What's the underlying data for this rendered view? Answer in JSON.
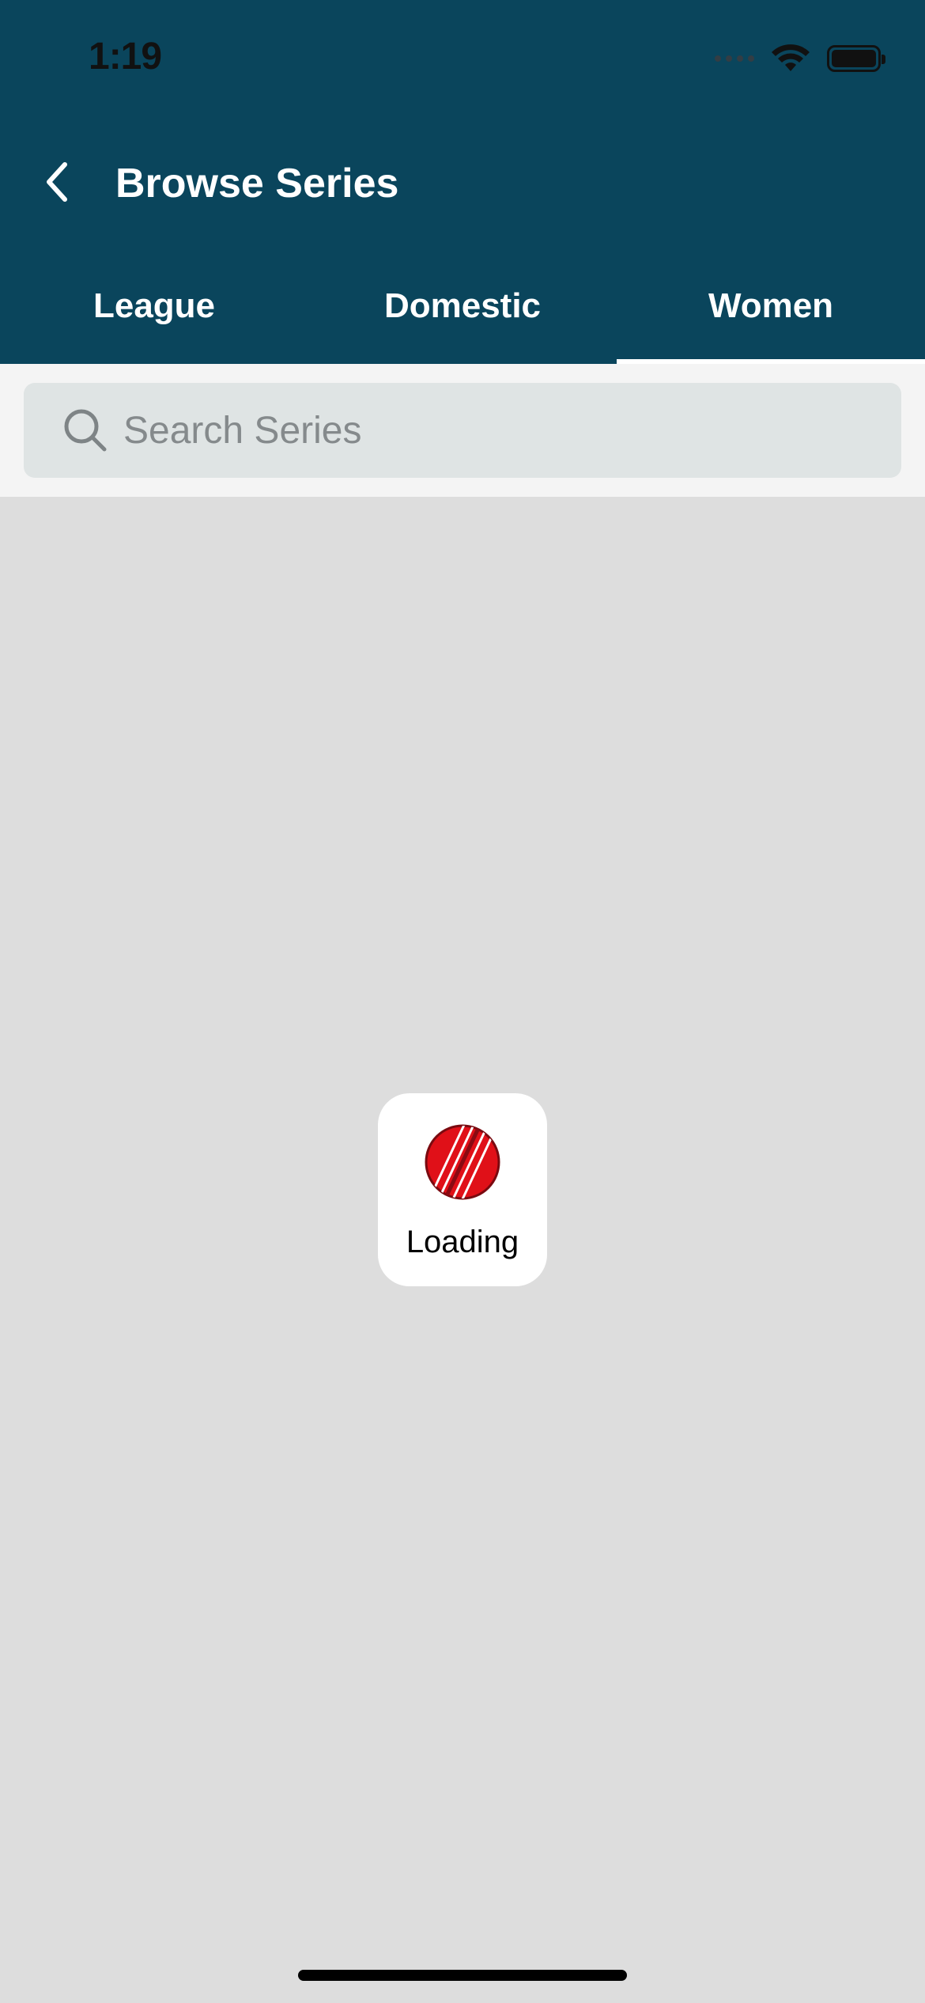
{
  "status_bar": {
    "time": "1:19"
  },
  "header": {
    "title": "Browse Series",
    "back_icon": "chevron-left-icon",
    "background_color": "#0a455c"
  },
  "tabs": [
    {
      "label": "League",
      "active": false
    },
    {
      "label": "Domestic",
      "active": false
    },
    {
      "label": "Women",
      "active": true
    }
  ],
  "search": {
    "placeholder": "Search Series",
    "value": "",
    "icon": "search-icon"
  },
  "loader": {
    "label": "Loading",
    "icon": "cricket-ball-icon",
    "icon_color": "#e01018"
  }
}
